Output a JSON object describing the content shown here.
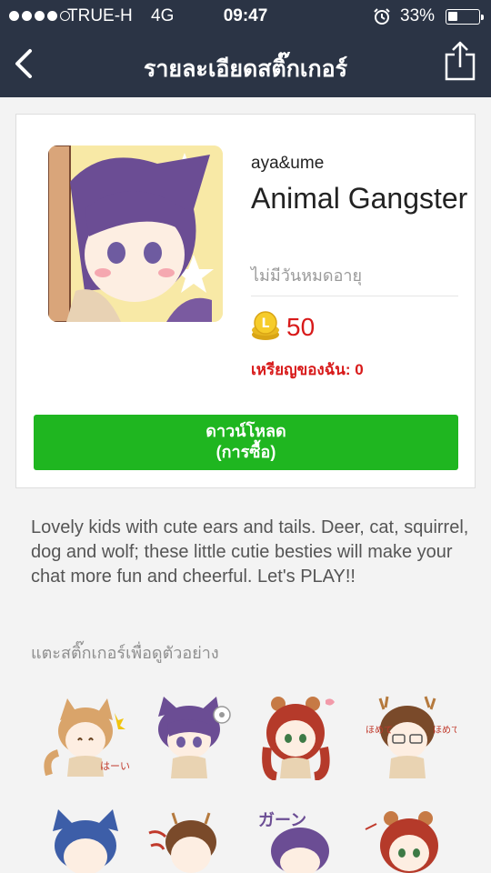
{
  "status_bar": {
    "carrier": "TRUE-H",
    "network": "4G",
    "time": "09:47",
    "battery_text": "33%",
    "battery_level": 0.33
  },
  "nav": {
    "back_icon": "chevron-left-icon",
    "title": "รายละเอียดสติ๊กเกอร์",
    "share_icon": "share-icon"
  },
  "product": {
    "author": "aya&ume",
    "title": "Animal Gangster",
    "expiry": "ไม่มีวันหมดอายุ",
    "price": "50",
    "my_coins": "เหรียญของฉัน: 0",
    "download_label": "ดาวน์โหลด\n(การซื้อ)"
  },
  "description": "Lovely kids with cute ears and tails. Deer, cat, squirrel, dog and wolf; these little cutie besties will make your chat more fun and cheerful. Let's PLAY!!",
  "preview_hint": "แตะสติ๊กเกอร์เพื่อดูตัวอย่าง",
  "sticker_text": {
    "s1": "はーい",
    "s4a": "ほめて",
    "s4b": "ほめて",
    "s5": "ガーン"
  },
  "colors": {
    "topbar": "#2b3445",
    "accent_green": "#1fb620",
    "price_red": "#d81a1a"
  }
}
